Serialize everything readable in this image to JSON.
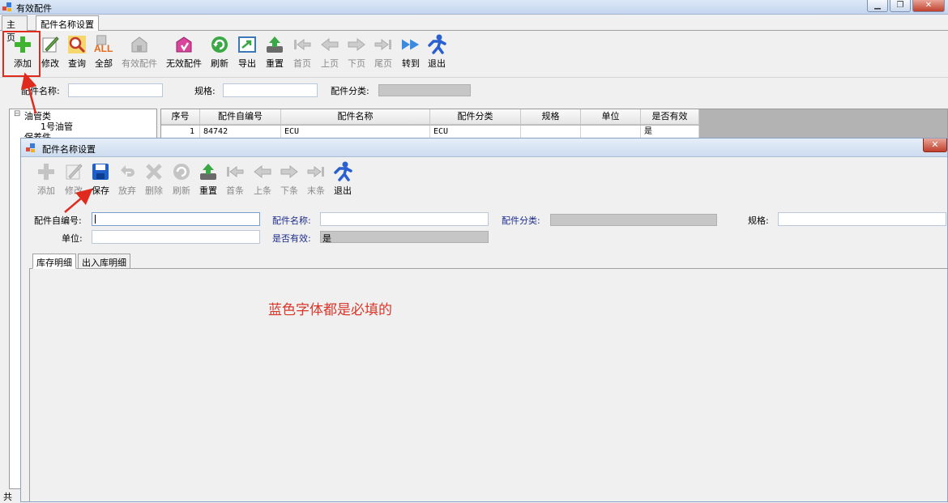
{
  "window": {
    "title": "有效配件",
    "minimize": "▁",
    "restore": "❐",
    "close": "✕"
  },
  "tabs": [
    {
      "label": "主页"
    },
    {
      "label": "配件名称设置"
    }
  ],
  "toolbar": [
    {
      "label": "添加",
      "icon": "add-icon",
      "enabled": true
    },
    {
      "label": "修改",
      "icon": "edit-icon",
      "enabled": true
    },
    {
      "label": "查询",
      "icon": "search-icon",
      "enabled": true
    },
    {
      "label": "全部",
      "icon": "all-icon",
      "enabled": true
    },
    {
      "label": "有效配件",
      "icon": "valid-parts-icon",
      "enabled": false
    },
    {
      "label": "无效配件",
      "icon": "invalid-parts-icon",
      "enabled": true
    },
    {
      "label": "刷新",
      "icon": "refresh-icon",
      "enabled": true
    },
    {
      "label": "导出",
      "icon": "export-icon",
      "enabled": true
    },
    {
      "label": "重置",
      "icon": "reset-icon",
      "enabled": true
    },
    {
      "label": "首页",
      "icon": "first-page-icon",
      "enabled": false
    },
    {
      "label": "上页",
      "icon": "prev-page-icon",
      "enabled": false
    },
    {
      "label": "下页",
      "icon": "next-page-icon",
      "enabled": false
    },
    {
      "label": "尾页",
      "icon": "last-page-icon",
      "enabled": false
    },
    {
      "label": "转到",
      "icon": "goto-icon",
      "enabled": true
    },
    {
      "label": "退出",
      "icon": "exit-icon",
      "enabled": true
    }
  ],
  "filters": {
    "name_label": "配件名称:",
    "spec_label": "规格:",
    "category_label": "配件分类:"
  },
  "tree": {
    "items": [
      "油管类",
      "1号油管",
      "保养件"
    ],
    "collapse_glyph": "⊟"
  },
  "grid": {
    "columns": [
      "序号",
      "配件自编号",
      "配件名称",
      "配件分类",
      "规格",
      "单位",
      "是否有效"
    ],
    "rows": [
      [
        "1",
        "84742",
        "ECU",
        "ECU",
        "",
        "",
        "是"
      ]
    ]
  },
  "status_text": "共",
  "dialog": {
    "title": "配件名称设置",
    "close": "✕",
    "toolbar": [
      {
        "label": "添加",
        "icon": "add-icon",
        "enabled": false
      },
      {
        "label": "修改",
        "icon": "edit-icon",
        "enabled": false
      },
      {
        "label": "保存",
        "icon": "save-icon",
        "enabled": true
      },
      {
        "label": "放弃",
        "icon": "undo-icon",
        "enabled": false
      },
      {
        "label": "删除",
        "icon": "delete-icon",
        "enabled": false
      },
      {
        "label": "刷新",
        "icon": "refresh-icon",
        "enabled": false
      },
      {
        "label": "重置",
        "icon": "reset-icon",
        "enabled": true
      },
      {
        "label": "首条",
        "icon": "first-record-icon",
        "enabled": false
      },
      {
        "label": "上条",
        "icon": "prev-record-icon",
        "enabled": false
      },
      {
        "label": "下条",
        "icon": "next-record-icon",
        "enabled": false
      },
      {
        "label": "末条",
        "icon": "last-record-icon",
        "enabled": false
      },
      {
        "label": "退出",
        "icon": "exit-icon",
        "enabled": true
      }
    ],
    "fields": {
      "code_label": "配件自编号:",
      "name_label": "配件名称:",
      "category_label": "配件分类:",
      "spec_label": "规格:",
      "unit_label": "单位:",
      "valid_label": "是否有效:",
      "valid_value": "是"
    },
    "subtabs": [
      "库存明细",
      "出入库明细"
    ],
    "note": "蓝色字体都是必填的"
  },
  "colors": {
    "annotation_red": "#e02a1e",
    "required_label_blue": "#1c2b8c",
    "note_red": "#d8372a"
  }
}
